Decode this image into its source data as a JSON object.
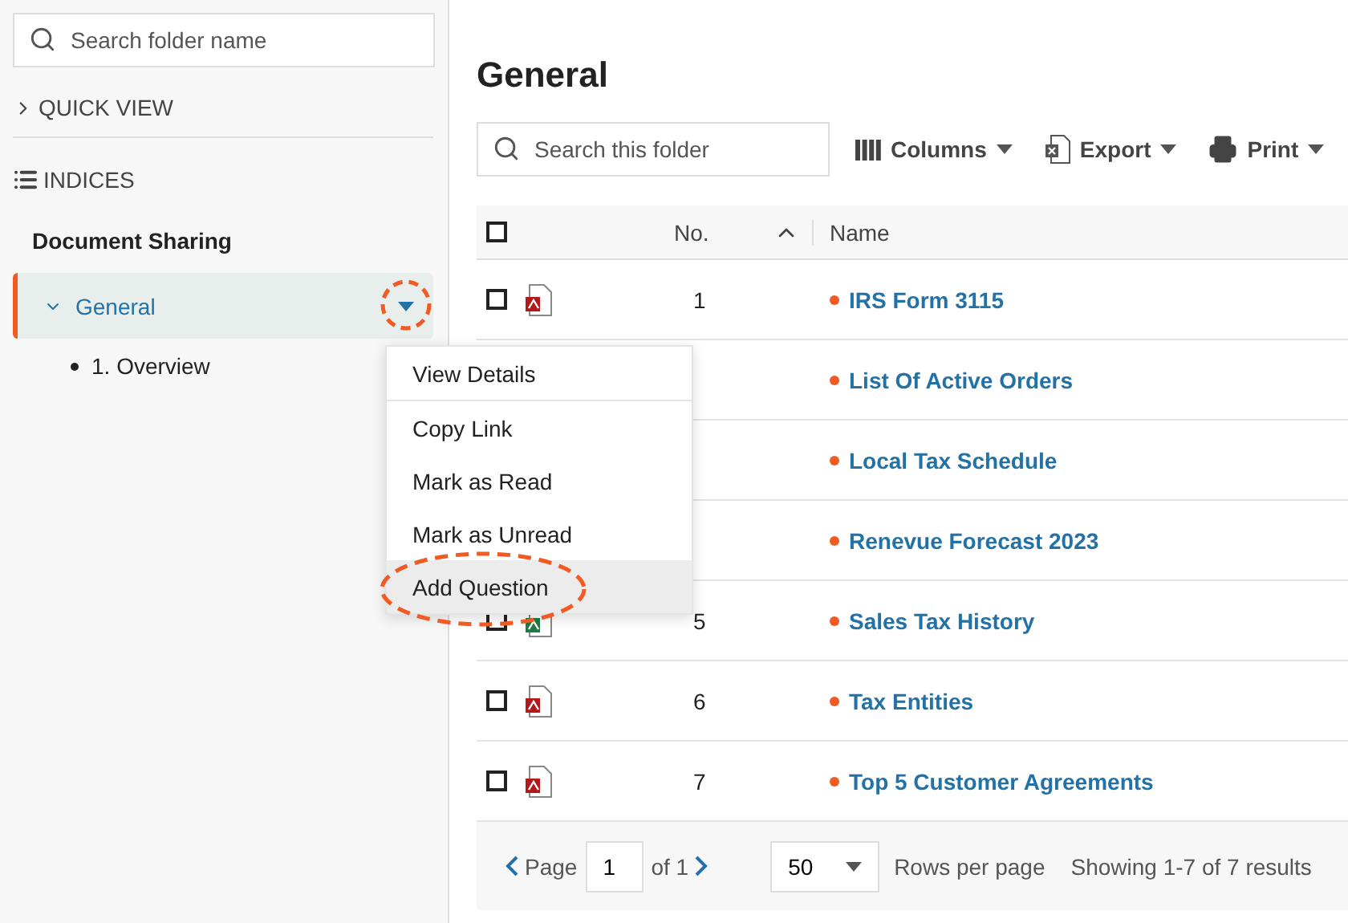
{
  "sidebar": {
    "search": {
      "placeholder": "Search folder name"
    },
    "quick_view": {
      "label": "QUICK VIEW",
      "expanded": false
    },
    "indices": {
      "label": "INDICES"
    },
    "tree": {
      "title": "Document Sharing",
      "items": [
        {
          "label": "General",
          "selected": true,
          "expanded": true,
          "menu_circled": true,
          "children": [
            {
              "label": "1. Overview"
            }
          ]
        }
      ]
    }
  },
  "main": {
    "title": "General",
    "search": {
      "placeholder": "Search this folder"
    },
    "toolbar": [
      {
        "label": "Columns",
        "kind": "columns"
      },
      {
        "label": "Export",
        "kind": "export"
      },
      {
        "label": "Print",
        "kind": "print"
      }
    ],
    "table": {
      "header_checkbox": {
        "checked": false
      },
      "columns": [
        {
          "label": "No.",
          "sort_ascending": true
        },
        {
          "label": "Name"
        }
      ],
      "rows": [
        {
          "number": "1",
          "name": "IRS Form 3115",
          "kind": "pdf",
          "checkbox": {
            "checked": false
          },
          "unread": true
        },
        {
          "name": "List Of Active Orders",
          "unread": true
        },
        {
          "name": "Local Tax Schedule",
          "unread": true
        },
        {
          "name": "Renevue Forecast 2023",
          "unread": true
        },
        {
          "number": "5",
          "name": "Sales Tax History",
          "kind": "excel",
          "checkbox": {
            "checked": false
          },
          "unread": true
        },
        {
          "number": "6",
          "name": "Tax Entities",
          "kind": "pdf",
          "checkbox": {
            "checked": false
          },
          "unread": true
        },
        {
          "number": "7",
          "name": "Top 5 Customer Agreements",
          "kind": "pdf",
          "checkbox": {
            "checked": false
          },
          "unread": true
        }
      ]
    },
    "pagination": {
      "page_label": "Page",
      "page": "1",
      "of_label": "of 1",
      "rows_per_page": "50",
      "rows_label": "Rows per page",
      "summary": "Showing 1-7 of 7 results"
    }
  },
  "context_menu": {
    "items": [
      {
        "label": "View Details",
        "hovered": false,
        "circled": false
      },
      {
        "label": "Copy Link",
        "hovered": false,
        "circled": false
      },
      {
        "label": "Mark as Read",
        "hovered": false,
        "circled": false
      },
      {
        "label": "Mark as Unread",
        "hovered": false,
        "circled": false
      },
      {
        "label": "Add Question",
        "hovered": true,
        "circled": true
      }
    ]
  }
}
